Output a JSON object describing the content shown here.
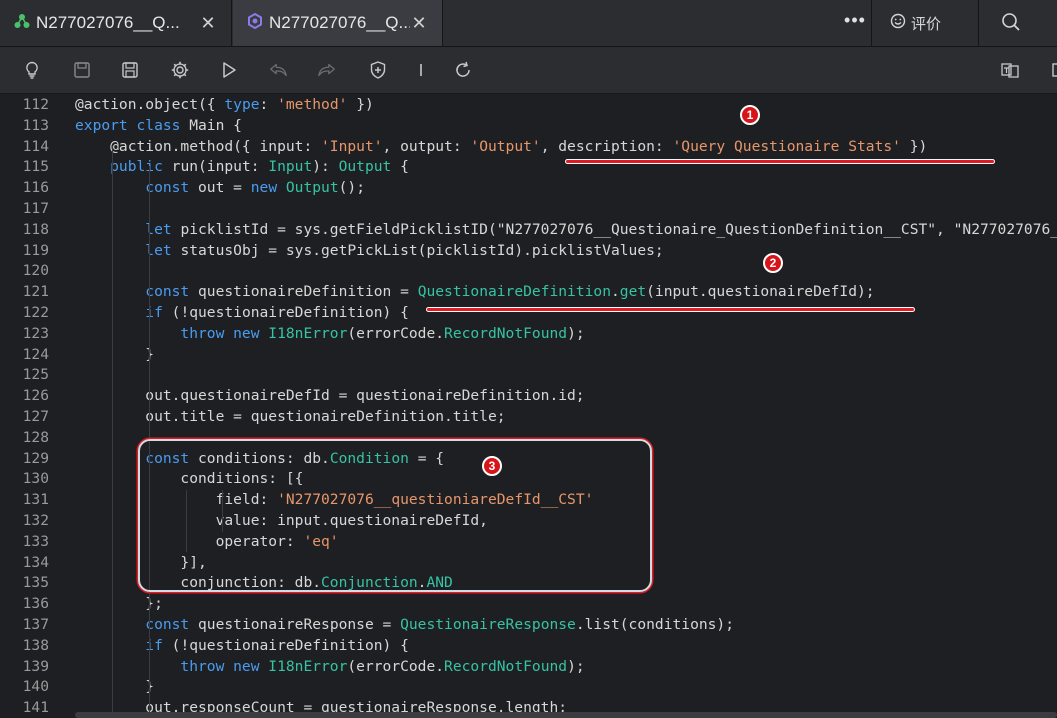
{
  "tabs": [
    {
      "label": "N277027076__Q...",
      "icon": "tree-icon"
    },
    {
      "label": "N277027076__Q...",
      "icon": "hexagon-icon"
    }
  ],
  "header": {
    "more_label": "•••",
    "review_label": "评价"
  },
  "toolbar_icons": [
    "bulb-icon",
    "save-icon",
    "save-all-icon",
    "gear-icon",
    "run-icon",
    "undo-icon",
    "redo-icon",
    "shield-icon",
    "separator-icon",
    "refresh-icon",
    "translate-icon",
    "split-icon"
  ],
  "colors": {
    "keyword": "#4a9cf0",
    "string": "#e7966b",
    "type": "#36c3a5",
    "annotation": "#e01b24"
  },
  "annotations": [
    "1",
    "2",
    "3"
  ],
  "code": [
    {
      "n": "112",
      "c": [
        [
          "",
          "@action.object({ "
        ],
        [
          "k",
          "type"
        ],
        [
          "",
          ": "
        ],
        [
          "s",
          "'method'"
        ],
        [
          "",
          " })"
        ]
      ]
    },
    {
      "n": "113",
      "c": [
        [
          "k",
          "export class"
        ],
        [
          "",
          " Main {"
        ]
      ]
    },
    {
      "n": "114",
      "c": [
        [
          "",
          "    @action.method({ input: "
        ],
        [
          "s",
          "'Input'"
        ],
        [
          "",
          ", output: "
        ],
        [
          "s",
          "'Output'"
        ],
        [
          "",
          ", description: "
        ],
        [
          "s",
          "'Query Questionaire Stats'"
        ],
        [
          "",
          " })"
        ]
      ]
    },
    {
      "n": "115",
      "c": [
        [
          "k",
          "    public"
        ],
        [
          "",
          " run(input: "
        ],
        [
          "t",
          "Input"
        ],
        [
          "",
          "): "
        ],
        [
          "t",
          "Output"
        ],
        [
          "",
          " {"
        ]
      ]
    },
    {
      "n": "116",
      "c": [
        [
          "k",
          "        const"
        ],
        [
          "",
          " out = "
        ],
        [
          "k",
          "new"
        ],
        [
          "t",
          " Output"
        ],
        [
          "",
          "();"
        ]
      ]
    },
    {
      "n": "117",
      "c": []
    },
    {
      "n": "118",
      "c": [
        [
          "k",
          "        let"
        ],
        [
          "",
          " picklistId = sys.getFieldPicklistID(\"N277027076__Questionaire_QuestionDefinition__CST\", \"N277027076__"
        ]
      ]
    },
    {
      "n": "119",
      "c": [
        [
          "k",
          "        let"
        ],
        [
          "",
          " statusObj = sys.getPickList(picklistId).picklistValues;"
        ]
      ]
    },
    {
      "n": "120",
      "c": []
    },
    {
      "n": "121",
      "c": [
        [
          "k",
          "        const"
        ],
        [
          "",
          " questionaireDefinition = "
        ],
        [
          "t",
          "QuestionaireDefinition"
        ],
        [
          "",
          "."
        ],
        [
          "t",
          "get"
        ],
        [
          "",
          "(input.questionaireDefId);"
        ]
      ]
    },
    {
      "n": "122",
      "c": [
        [
          "k",
          "        if"
        ],
        [
          "",
          " (!questionaireDefinition) {"
        ]
      ]
    },
    {
      "n": "123",
      "c": [
        [
          "k",
          "            throw new"
        ],
        [
          "t",
          " I18nError"
        ],
        [
          "",
          "(errorCode."
        ],
        [
          "t",
          "RecordNotFound"
        ],
        [
          "",
          "); "
        ]
      ]
    },
    {
      "n": "124",
      "c": [
        [
          "",
          "        }"
        ]
      ]
    },
    {
      "n": "125",
      "c": []
    },
    {
      "n": "126",
      "c": [
        [
          "",
          "        out.questionaireDefId = questionaireDefinition.id;"
        ]
      ]
    },
    {
      "n": "127",
      "c": [
        [
          "",
          "        out.title = questionaireDefinition.title;"
        ]
      ]
    },
    {
      "n": "128",
      "c": []
    },
    {
      "n": "129",
      "c": [
        [
          "k",
          "        const"
        ],
        [
          "",
          " conditions: db."
        ],
        [
          "t",
          "Condition"
        ],
        [
          "",
          " = {"
        ]
      ]
    },
    {
      "n": "130",
      "c": [
        [
          "",
          "            conditions: [{"
        ]
      ]
    },
    {
      "n": "131",
      "c": [
        [
          "",
          "                field: "
        ],
        [
          "s",
          "'N277027076__questioniareDefId__CST'"
        ],
        [
          ","
        ]
      ]
    },
    {
      "n": "132",
      "c": [
        [
          "",
          "                value: input.questionaireDefId,"
        ]
      ]
    },
    {
      "n": "133",
      "c": [
        [
          "",
          "                operator: "
        ],
        [
          "s",
          "'eq'"
        ]
      ]
    },
    {
      "n": "134",
      "c": [
        [
          "",
          "            }],"
        ]
      ]
    },
    {
      "n": "135",
      "c": [
        [
          "",
          "            conjunction: db."
        ],
        [
          "t",
          "Conjunction"
        ],
        [
          "",
          "."
        ],
        [
          "t",
          "AND"
        ]
      ]
    },
    {
      "n": "136",
      "c": [
        [
          "",
          "        };"
        ]
      ]
    },
    {
      "n": "137",
      "c": [
        [
          "k",
          "        const"
        ],
        [
          "",
          " questionaireResponse = "
        ],
        [
          "t",
          "QuestionaireResponse"
        ],
        [
          "",
          ".list(conditions);"
        ]
      ]
    },
    {
      "n": "138",
      "c": [
        [
          "k",
          "        if"
        ],
        [
          "",
          " (!questionaireDefinition) {"
        ]
      ]
    },
    {
      "n": "139",
      "c": [
        [
          "k",
          "            throw new"
        ],
        [
          "t",
          " I18nError"
        ],
        [
          "",
          "(errorCode."
        ],
        [
          "t",
          "RecordNotFound"
        ],
        [
          "",
          "); "
        ]
      ]
    },
    {
      "n": "140",
      "c": [
        [
          "",
          "        }"
        ]
      ]
    },
    {
      "n": "141",
      "c": [
        [
          "",
          "        out.responseCount = questionaireResponse.length;"
        ]
      ]
    }
  ]
}
